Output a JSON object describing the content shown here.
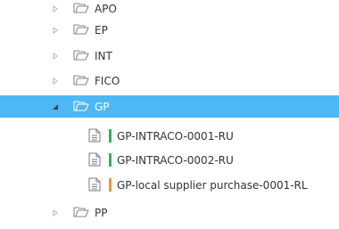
{
  "folders": [
    {
      "label": "APO"
    },
    {
      "label": "EP"
    },
    {
      "label": "INT"
    },
    {
      "label": "FICO"
    },
    {
      "label": "GP",
      "expanded": true,
      "selected": true
    },
    {
      "label": "PP"
    }
  ],
  "files": [
    {
      "label": "GP-INTRACO-0001-RU",
      "status_color": "#2fb25a"
    },
    {
      "label": "GP-INTRACO-0002-RU",
      "status_color": "#2fb25a"
    },
    {
      "label": "GP-local supplier purchase-0001-RL",
      "status_color": "#f0952a"
    }
  ],
  "colors": {
    "selection": "#4cb8f5",
    "text": "#333333",
    "icon": "#8a8a8a"
  },
  "icons": {
    "collapsed": "triangle-right-icon",
    "expanded": "triangle-down-icon",
    "folder": "open-folder-icon",
    "file": "document-icon"
  }
}
